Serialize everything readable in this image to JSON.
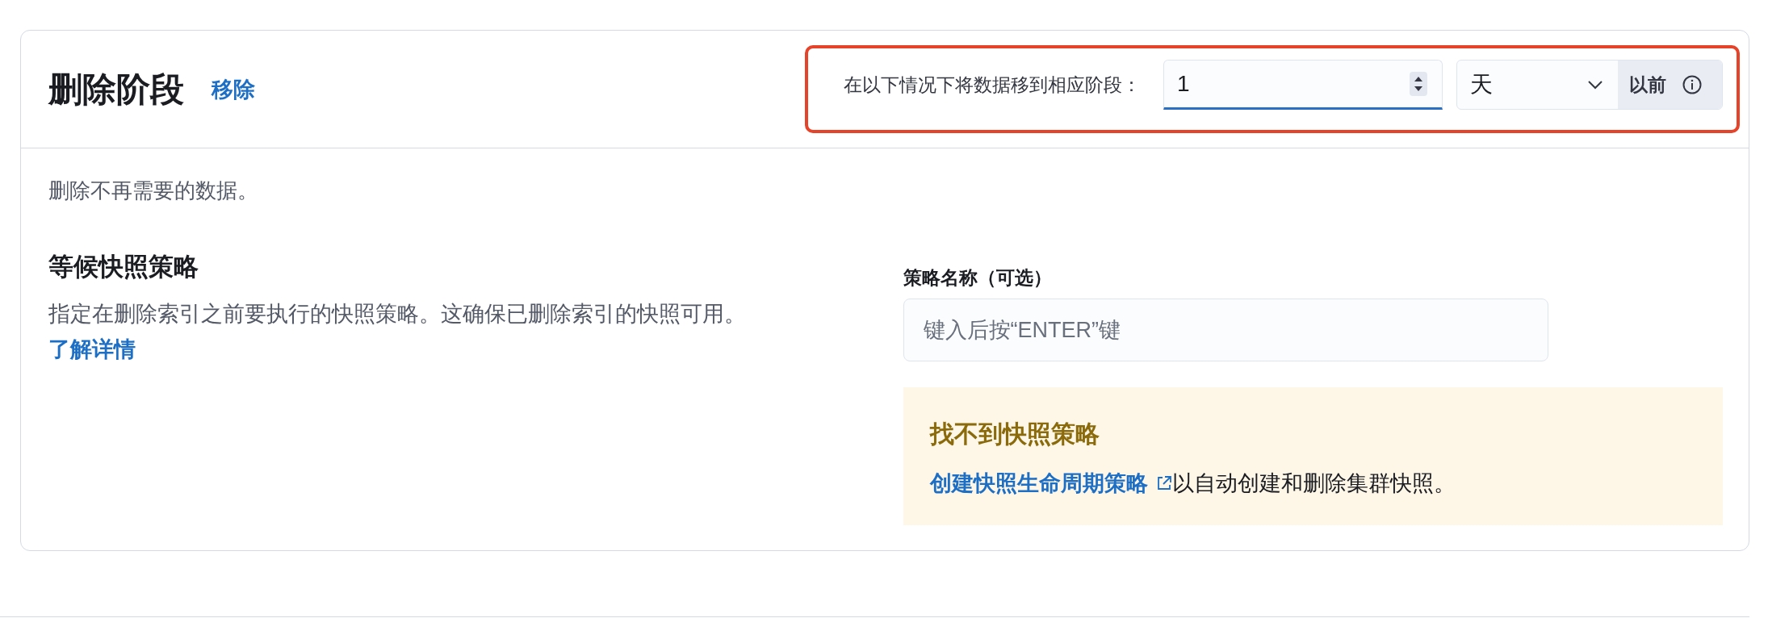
{
  "phase": {
    "title": "删除阶段",
    "remove_link": "移除"
  },
  "move_rule": {
    "highlighted": true,
    "label": "在以下情况下将数据移到相应阶段：",
    "value": "1",
    "focused": true,
    "unit": "天",
    "append": "以前"
  },
  "description": "删除不再需要的数据。",
  "wait_snapshot": {
    "title": "等候快照策略",
    "text": "指定在删除索引之前要执行的快照策略。这确保已删除索引的快照可用。",
    "link": "了解详情"
  },
  "policy_field": {
    "label": "策略名称（可选）",
    "placeholder": "键入后按“ENTER”键"
  },
  "callout": {
    "title": "找不到快照策略",
    "link": "创建快照生命周期策略",
    "text": "以自动创建和删除集群快照。"
  }
}
